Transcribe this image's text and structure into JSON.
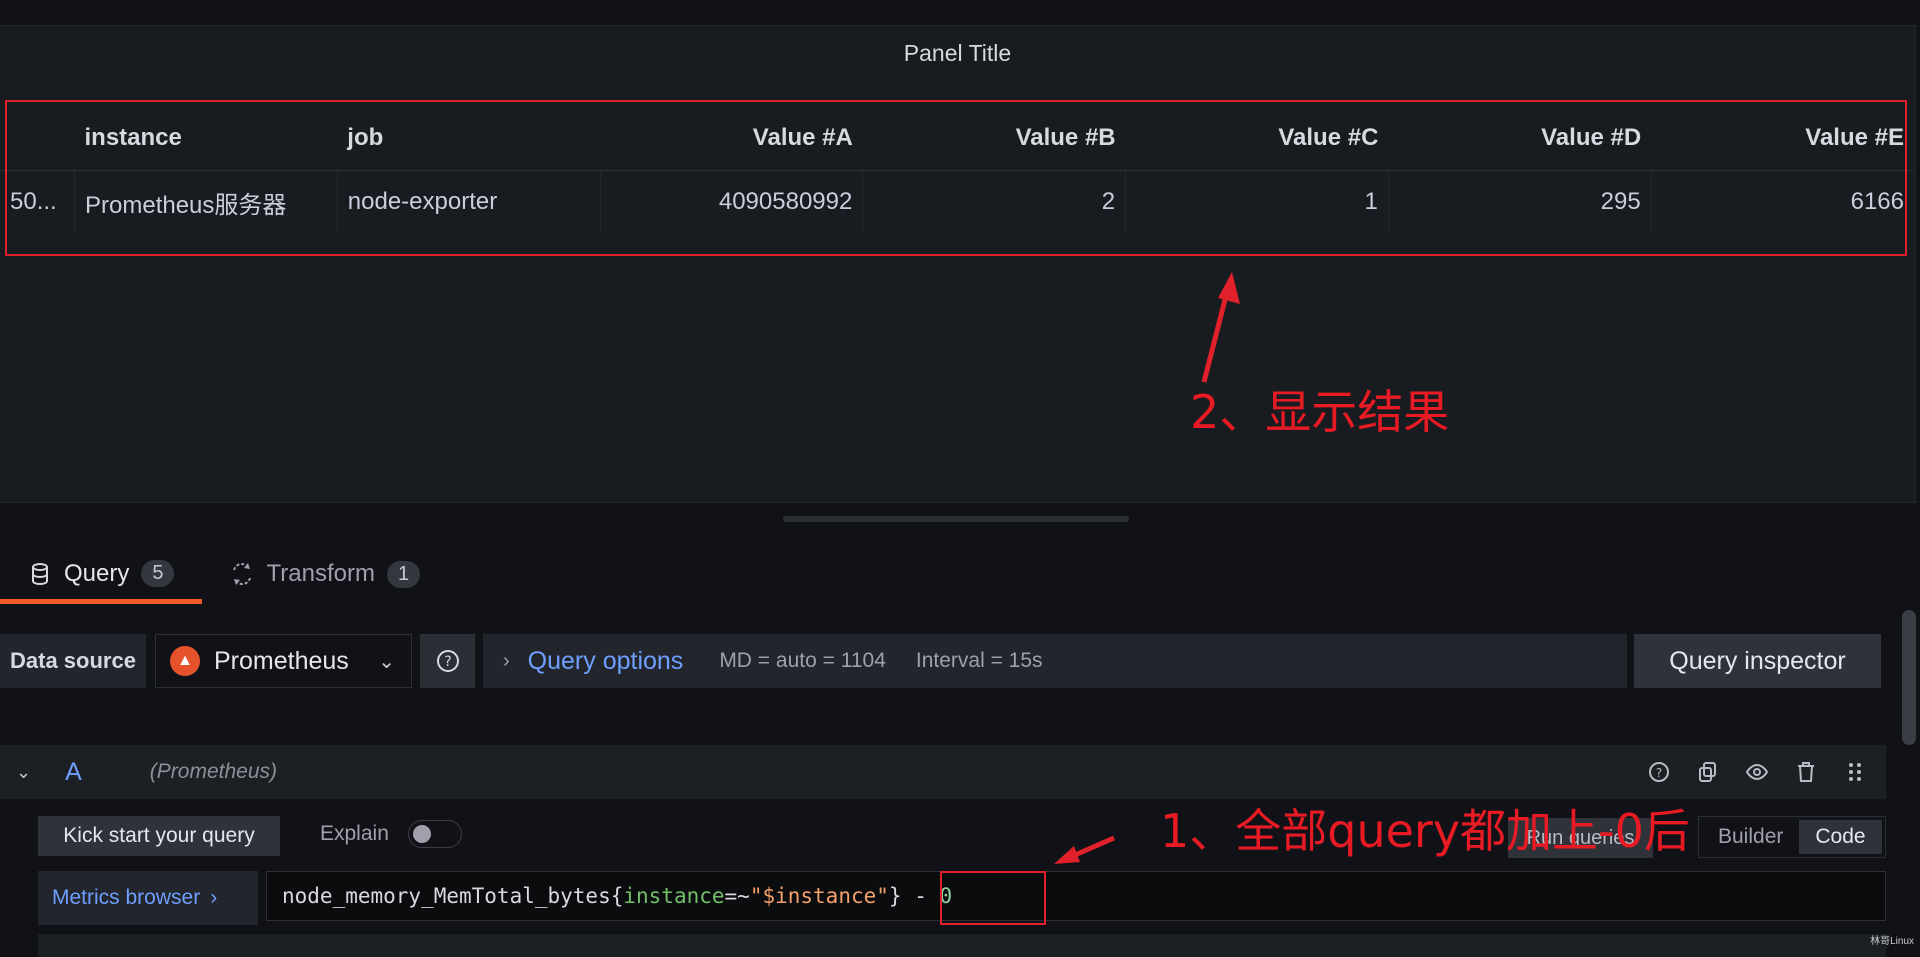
{
  "panel": {
    "title": "Panel Title",
    "table": {
      "columns": [
        "",
        "instance",
        "job",
        "Value #A",
        "Value #B",
        "Value #C",
        "Value #D",
        "Value #E"
      ],
      "rows": [
        [
          "50...",
          "Prometheus服务器",
          "node-exporter",
          "4090580992",
          "2",
          "1",
          "295",
          "6166"
        ]
      ]
    }
  },
  "annotations": {
    "result_note": "2、显示结果",
    "query_note": "1、全部query都加上-0后",
    "color": "#e0202a"
  },
  "tabs": [
    {
      "label": "Query",
      "count": "5",
      "icon": "database-icon",
      "active": true
    },
    {
      "label": "Transform",
      "count": "1",
      "icon": "transform-icon",
      "active": false
    }
  ],
  "toolbar": {
    "datasource_label": "Data source",
    "datasource_value": "Prometheus",
    "query_options_label": "Query options",
    "md_info": "MD = auto = 1104",
    "interval_info": "Interval = 15s",
    "inspector_label": "Query inspector"
  },
  "query_row": {
    "ref_id": "A",
    "datasource": "(Prometheus)",
    "kick_start_label": "Kick start your query",
    "explain_label": "Explain",
    "explain_enabled": false,
    "run_label": "Run queries",
    "mode_builder": "Builder",
    "mode_code": "Code",
    "active_mode": "Code",
    "metrics_browser_label": "Metrics browser",
    "expr": {
      "metric": "node_memory_MemTotal_bytes{",
      "label": "instance",
      "op": "=~",
      "value": "\"$instance\"",
      "close": "}",
      "suffix_op": " - ",
      "suffix_num": "0"
    }
  },
  "watermark": "林哥Linux"
}
